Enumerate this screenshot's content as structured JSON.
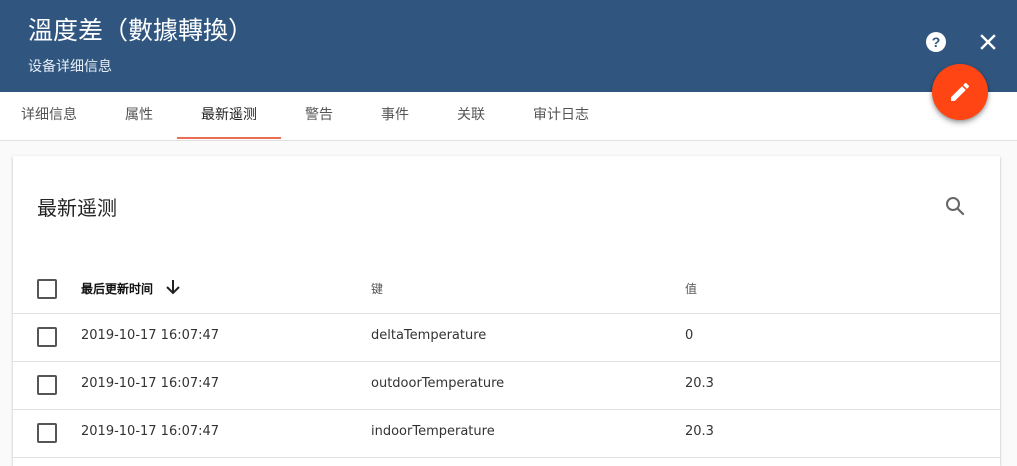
{
  "header": {
    "title": "溫度差（數據轉換）",
    "subtitle": "设备详细信息"
  },
  "icons": {
    "help": "help-circle-icon",
    "close": "close-icon",
    "edit": "pencil-icon",
    "search": "search-icon",
    "sort": "arrow-down-icon"
  },
  "colors": {
    "header_bg": "#305680",
    "fab": "#ff4513",
    "tab_ink": "#e86e54"
  },
  "tabs": [
    {
      "label": "详细信息",
      "active": false
    },
    {
      "label": "属性",
      "active": false
    },
    {
      "label": "最新遥测",
      "active": true
    },
    {
      "label": "警告",
      "active": false
    },
    {
      "label": "事件",
      "active": false
    },
    {
      "label": "关联",
      "active": false
    },
    {
      "label": "审计日志",
      "active": false
    }
  ],
  "card": {
    "title": "最新遥测"
  },
  "table": {
    "columns": {
      "time": "最后更新时间",
      "key": "键",
      "value": "值"
    },
    "rows": [
      {
        "time": "2019-10-17 16:07:47",
        "key": "deltaTemperature",
        "value": "0"
      },
      {
        "time": "2019-10-17 16:07:47",
        "key": "outdoorTemperature",
        "value": "20.3"
      },
      {
        "time": "2019-10-17 16:07:47",
        "key": "indoorTemperature",
        "value": "20.3"
      }
    ]
  }
}
